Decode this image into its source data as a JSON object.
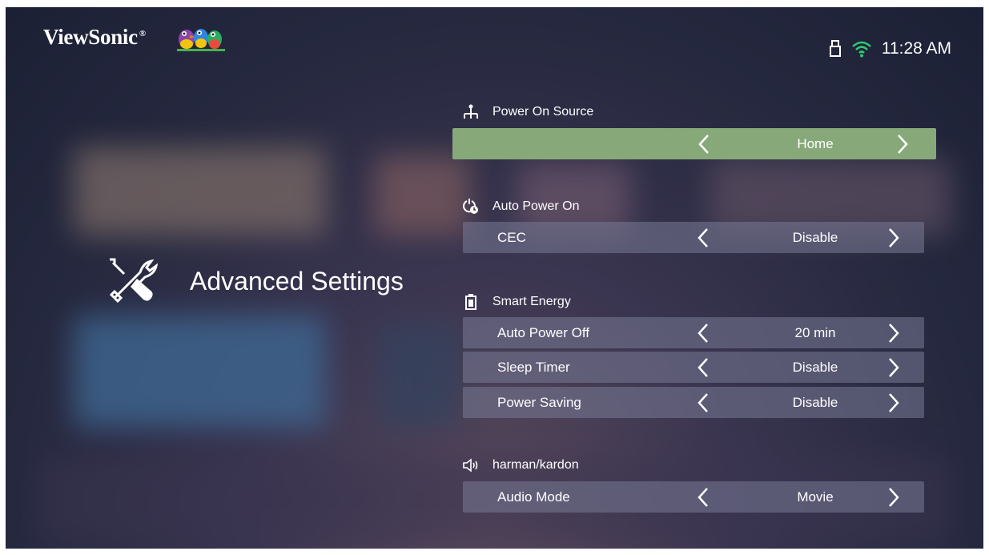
{
  "brand": {
    "name": "ViewSonic",
    "reg": "®"
  },
  "status_bar": {
    "time": "11:28 AM",
    "icons": [
      "usb-drive-icon",
      "wifi-icon"
    ],
    "wifi_color": "#2ecc71"
  },
  "page": {
    "title": "Advanced Settings",
    "icon": "tools-icon"
  },
  "colors": {
    "selected_row": "#87a979",
    "row_bg": "rgba(120,122,150,0.55)"
  },
  "sections": [
    {
      "heading": "Power On Source",
      "icon": "network-source-icon",
      "rows": [
        {
          "label": "",
          "value": "Home",
          "selected": true
        }
      ]
    },
    {
      "heading": "Auto Power On",
      "icon": "power-timer-icon",
      "rows": [
        {
          "label": "CEC",
          "value": "Disable",
          "selected": false
        }
      ]
    },
    {
      "heading": "Smart Energy",
      "icon": "battery-icon",
      "rows": [
        {
          "label": "Auto Power Off",
          "value": "20 min",
          "selected": false
        },
        {
          "label": "Sleep Timer",
          "value": "Disable",
          "selected": false
        },
        {
          "label": "Power Saving",
          "value": "Disable",
          "selected": false
        }
      ]
    },
    {
      "heading": "harman/kardon",
      "icon": "speaker-icon",
      "rows": [
        {
          "label": "Audio Mode",
          "value": "Movie",
          "selected": false
        }
      ]
    }
  ]
}
